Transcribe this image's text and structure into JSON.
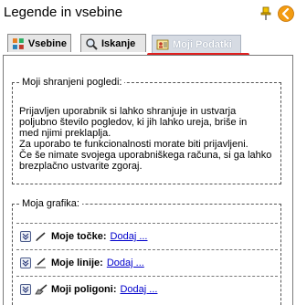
{
  "header": {
    "title": "Legende in vsebine",
    "pin_icon": "pin-icon",
    "back_icon": "back-arrow-icon",
    "back_color": "#f39c12"
  },
  "tabs": [
    {
      "label": "Vsebine",
      "icon": "grid-icon"
    },
    {
      "label": "Iskanje",
      "icon": "search-icon"
    },
    {
      "label": "Moji Podatki",
      "icon": "user-card-icon",
      "active": true
    }
  ],
  "saved_views": {
    "legend": "Moji shranjeni pogledi:",
    "lines": [
      "Prijavljen uporabnik si lahko shranjuje in ustvarja",
      "poljubno število pogledov, ki jih lahko ureja, briše in",
      "med njimi preklaplja.",
      "Za uporabo te funkcionalnosti morate biti prijavljeni.",
      "Če še nimate svojega uporabniškega računa, si ga lahko",
      "brezplačno ustvarite zgoraj."
    ]
  },
  "graphics": {
    "legend": "Moja grafika:",
    "rows": [
      {
        "label": "Moje točke:",
        "link": "Dodaj ..."
      },
      {
        "label": "Moje linije:",
        "link": "Dodaj ..."
      },
      {
        "label": "Moji poligoni:",
        "link": "Dodaj ..."
      }
    ]
  },
  "colors": {
    "highlight": "#e02020",
    "link": "#0000cc"
  }
}
